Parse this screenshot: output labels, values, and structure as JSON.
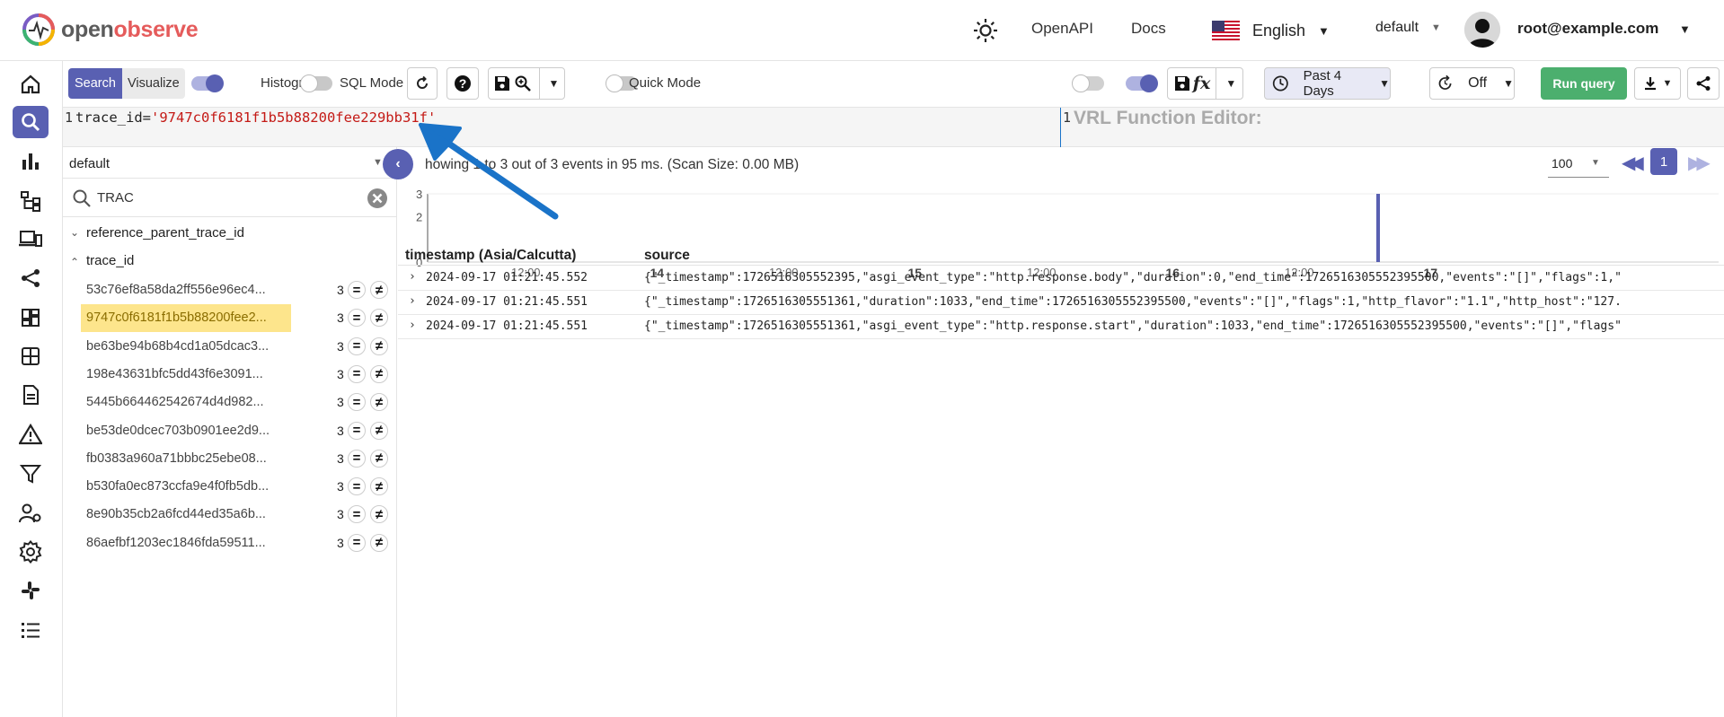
{
  "header": {
    "brand_open": "open",
    "brand_observe": "observe",
    "openapi": "OpenAPI",
    "docs": "Docs",
    "language": "English",
    "org": "default",
    "user": "root@example.com"
  },
  "toolbar": {
    "search_tab": "Search",
    "visualize_tab": "Visualize",
    "histogram_label": "Histogram",
    "histogram_on": true,
    "sql_mode_label": "SQL Mode",
    "sql_mode_on": false,
    "quick_mode_label": "Quick Mode",
    "quick_mode_on": false,
    "time_range": "Past 4 Days",
    "refresh": "Off",
    "run_query": "Run query",
    "fx_label": "fx"
  },
  "query": {
    "line_no": "1",
    "key": "trace_id=",
    "value": "'9747c0f6181f1b5b88200fee229bb31f'",
    "vrl_line_no": "1",
    "vrl_title": "VRL Function Editor:"
  },
  "fields": {
    "stream": "default",
    "search_value": "TRAC",
    "groups": [
      {
        "name": "reference_parent_trace_id",
        "expanded": false
      },
      {
        "name": "trace_id",
        "expanded": true
      }
    ],
    "trace_values": [
      {
        "id": "53c76ef8a58da2ff556e96ec4...",
        "count": "3",
        "highlight": false
      },
      {
        "id": "9747c0f6181f1b5b88200fee2...",
        "count": "3",
        "highlight": true
      },
      {
        "id": "be63be94b68b4cd1a05dcac3...",
        "count": "3",
        "highlight": false
      },
      {
        "id": "198e43631bfc5dd43f6e3091...",
        "count": "3",
        "highlight": false
      },
      {
        "id": "5445b664462542674d4d982...",
        "count": "3",
        "highlight": false
      },
      {
        "id": "be53de0dcec703b0901ee2d9...",
        "count": "3",
        "highlight": false
      },
      {
        "id": "fb0383a960a71bbbc25ebe08...",
        "count": "3",
        "highlight": false
      },
      {
        "id": "b530fa0ec873ccfa9e4f0fb5db...",
        "count": "3",
        "highlight": false
      },
      {
        "id": "8e90b35cb2a6fcd44ed35a6b...",
        "count": "3",
        "highlight": false
      },
      {
        "id": "86aefbf1203ec1846fda59511...",
        "count": "3",
        "highlight": false
      }
    ],
    "eq_symbol": "=",
    "ne_symbol": "≠"
  },
  "results": {
    "summary": "Showing 1 to 3 out of 3 events in 95 ms. (Scan Size: 0.00 MB)",
    "summary_visible": "howing 1 to 3 out of 3 events in 95 ms. (Scan Size: 0.00 MB)",
    "page_size": "100",
    "page": "1",
    "col_timestamp": "timestamp (Asia/Calcutta)",
    "col_source": "source",
    "rows": [
      {
        "ts": "2024-09-17 01:21:45.552",
        "src": "{\"_timestamp\":1726516305552395,\"asgi_event_type\":\"http.response.body\",\"duration\":0,\"end_time\":1726516305552395500,\"events\":\"[]\",\"flags\":1,\""
      },
      {
        "ts": "2024-09-17 01:21:45.551",
        "src": "{\"_timestamp\":1726516305551361,\"duration\":1033,\"end_time\":1726516305552395500,\"events\":\"[]\",\"flags\":1,\"http_flavor\":\"1.1\",\"http_host\":\"127."
      },
      {
        "ts": "2024-09-17 01:21:45.551",
        "src": "{\"_timestamp\":1726516305551361,\"asgi_event_type\":\"http.response.start\",\"duration\":1033,\"end_time\":1726516305552395500,\"events\":\"[]\",\"flags\""
      }
    ]
  },
  "chart_data": {
    "type": "bar",
    "title": "",
    "xlabel": "",
    "ylabel": "",
    "ylim": [
      0,
      3
    ],
    "y_ticks": [
      "3",
      "2",
      "0"
    ],
    "x_ticks": [
      {
        "label": "12:00",
        "bold": false
      },
      {
        "label": "14",
        "bold": true
      },
      {
        "label": "12:00",
        "bold": false
      },
      {
        "label": "15",
        "bold": true
      },
      {
        "label": "12:00",
        "bold": false
      },
      {
        "label": "16",
        "bold": true
      },
      {
        "label": "12:00",
        "bold": false
      },
      {
        "label": "17",
        "bold": true
      }
    ],
    "x_range": [
      "2024-09-13 12:00",
      "2024-09-17 01:21"
    ],
    "series": [
      {
        "values": [
          {
            "x": "2024-09-17 01:21",
            "y": 3
          }
        ]
      }
    ],
    "color": "#5960b2"
  },
  "colors": {
    "accent": "#5960b2",
    "run_query": "#4caf6e",
    "highlight": "#fde58c",
    "arrow": "#1a73c8",
    "query_value": "#c41a16"
  }
}
